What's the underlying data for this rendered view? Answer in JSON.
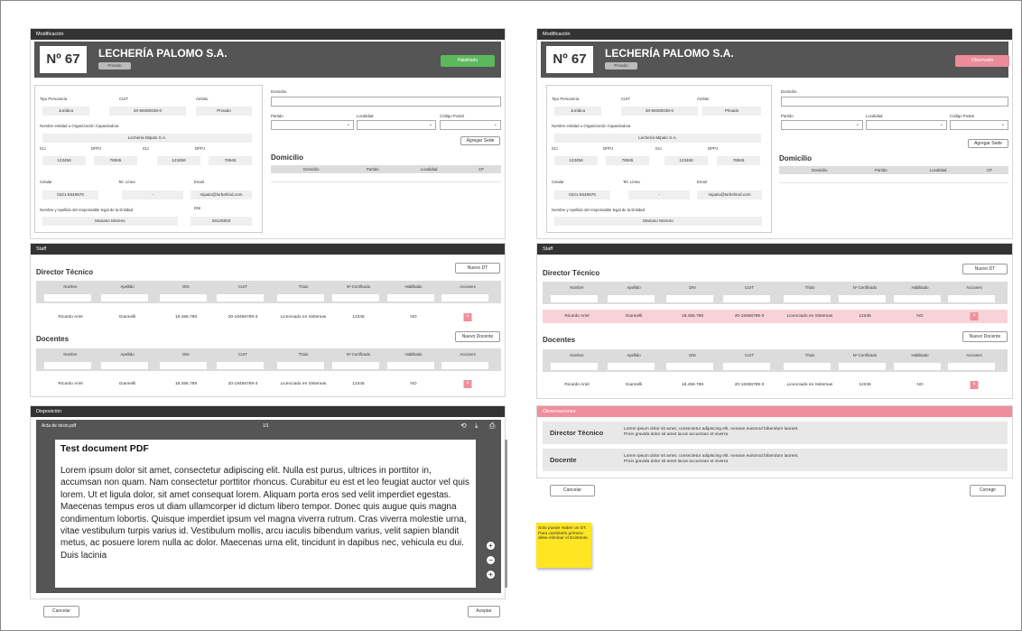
{
  "left": {
    "panel_title": "Modificación",
    "number": "Nº 67",
    "company": "LECHERÍA PALOMO S.A.",
    "tipo": "Privado",
    "status": "Habilitado",
    "fields": {
      "tipo_persona_label": "Tipo Personeria",
      "tipo_persona": "Jurídica",
      "cuit_label": "CUIT",
      "cuit": "30-68460036-0",
      "ambito_label": "Ámbito",
      "ambito": "Privado",
      "nombre_label": "Nombre entidad u Organización Capacitadora",
      "nombre": "Lechería Mipalo S.A.",
      "igj_label": "IGJ",
      "igj": "123456",
      "dppj_label": "DPPJ",
      "dppj": "78945",
      "igj2_label": "IGJ",
      "igj2": "123456",
      "dppj2_label": "DPPJ",
      "dppj2": "78945",
      "celular_label": "Celular",
      "celular": "0221-5648978",
      "tel_label": "Tel. Línea",
      "tel": "-",
      "email_label": "Email",
      "email": "mipalo@lorbehind.com",
      "resp_label": "Nombre y Apellido del responsable legal de la Entidad",
      "resp": "Mariano Moreno",
      "dni_label": "DNI",
      "dni": "28125803"
    },
    "domicilio_label": "Domicilio",
    "partido_label": "Partido",
    "localidad_label": "Localidad",
    "cp_label": "Código Postal",
    "agregar_sede": "Agregar Sede",
    "domicilio_heading": "Domicilio",
    "dom_cols": [
      "Domicilio",
      "Partido",
      "Localidad",
      "CP"
    ],
    "staff_title": "Staff",
    "dt_heading": "Director Técnico",
    "nuevo_dt": "Nuevo DT",
    "doc_heading": "Docentes",
    "nuevo_docente": "Nuevo Docente",
    "cols": [
      "Nombre",
      "Apellido",
      "DNI",
      "CUIT",
      "Título",
      "Nº Certificado",
      "Habilitado",
      "Acciones"
    ],
    "dt_row": [
      "Ricardo Ariel",
      "Giannelli",
      "18.456.789",
      "20-18456789-3",
      "Licenciado en Sistemas",
      "12345",
      "NO"
    ],
    "doc_row": [
      "Ricardo Ariel",
      "Giannelli",
      "18.456.789",
      "20-18456789-3",
      "Licenciado en Sistemas",
      "12345",
      "NO"
    ],
    "disp_title": "Disposición",
    "pdf_name": "Acta de inicio.pdf",
    "pdf_pages": "1/1",
    "pdf_title": "Test document PDF",
    "pdf_text": "Lorem ipsum dolor sit amet, consectetur adipiscing elit. Nulla est purus, ultrices in porttitor in, accumsan non quam. Nam consectetur porttitor rhoncus. Curabitur eu est et leo feugiat auctor vel quis lorem. Ut et ligula dolor, sit amet consequat lorem. Aliquam porta eros sed velit imperdiet egestas. Maecenas tempus eros ut diam ullamcorper id dictum libero tempor. Donec quis augue quis magna condimentum lobortis. Quisque imperdiet ipsum vel magna viverra rutrum. Cras viverra molestie urna, vitae vestibulum turpis varius id. Vestibulum mollis, arcu iaculis bibendum varius, velit sapien blandit metus, ac posuere lorem nulla ac dolor. Maecenas urna elit, tincidunt in dapibus nec, vehicula eu dui. Duis lacinia",
    "cancelar": "Cancelar",
    "aceptar": "Aceptar"
  },
  "right": {
    "panel_title": "Modificación",
    "number": "Nº 67",
    "company": "LECHERÍA PALOMO S.A.",
    "tipo": "Privado",
    "status": "Observado",
    "fields": {
      "tipo_persona_label": "Tipo Personeria",
      "tipo_persona": "Jurídica",
      "cuit_label": "CUIT",
      "cuit": "30-68460036-0",
      "ambito_label": "Ámbito",
      "ambito": "Privado",
      "nombre_label": "Nombre entidad u Organización Capacitadora",
      "nombre": "Lechería Mipalo S.A.",
      "igj_label": "IGJ",
      "igj": "123456",
      "dppj_label": "DPPJ",
      "dppj": "78945",
      "igj2_label": "IGJ",
      "igj2": "123456",
      "dppj2_label": "DPPJ",
      "dppj2": "78945",
      "celular_label": "Celular",
      "celular": "0221-5648978",
      "tel_label": "Tel. Línea",
      "tel": "-",
      "email_label": "Email",
      "email": "mipalo@lorbehind.com",
      "resp_label": "Nombre y Apellido del responsable legal de la Entidad",
      "resp": "Mariano Moreno"
    },
    "domicilio_label": "Domicilio",
    "partido_label": "Partido",
    "localidad_label": "Localidad",
    "cp_label": "Código Postal",
    "agregar_sede": "Agregar Sede",
    "domicilio_heading": "Domicilio",
    "dom_cols": [
      "Domicilio",
      "Partido",
      "Localidad",
      "CP"
    ],
    "staff_title": "Staff",
    "dt_heading": "Director Técnico",
    "nuevo_dt": "Nuevo DT",
    "doc_heading": "Docentes",
    "nuevo_docente": "Nuevo Docente",
    "cols": [
      "Nombre",
      "Apellido",
      "DNI",
      "CUIT",
      "Título",
      "Nº Certificado",
      "Habilitado",
      "Acciones"
    ],
    "dt_row": [
      "Ricardo Ariel",
      "Giannelli",
      "18.456.789",
      "20-18456789-3",
      "Licenciado en Sistemas",
      "12345",
      "NO"
    ],
    "doc_row": [
      "Ricardo Ariel",
      "Giannelli",
      "18.456.789",
      "20-18456789-3",
      "Licenciado en Sistemas",
      "12345",
      "NO"
    ],
    "obs_title": "Observaciones",
    "obs_dt_label": "Director Técnico",
    "obs_dt_text": "Lorem ipsum dolor sit amet, consectetur adipiscing elit. Aenean euismod bibendum laoreet. Proin gravida dolor sit amet lacus accumsan et viverra",
    "obs_doc_label": "Docente",
    "obs_doc_text": "Lorem ipsum dolor sit amet, consectetur adipiscing elit. Aenean euismod bibendum laoreet. Proin gravida dolor sit amet lacus accumsan et viverra",
    "cancelar": "Cancelar",
    "corregir": "Corregir"
  },
  "note": "Solo puede Haber un DT. Para cambiarlo primero debe eliminar el Existente",
  "colors": {
    "dark": "#333333",
    "green": "#5cb85c",
    "pink": "#ef8e9c",
    "rowpink": "#f7d3d9"
  }
}
